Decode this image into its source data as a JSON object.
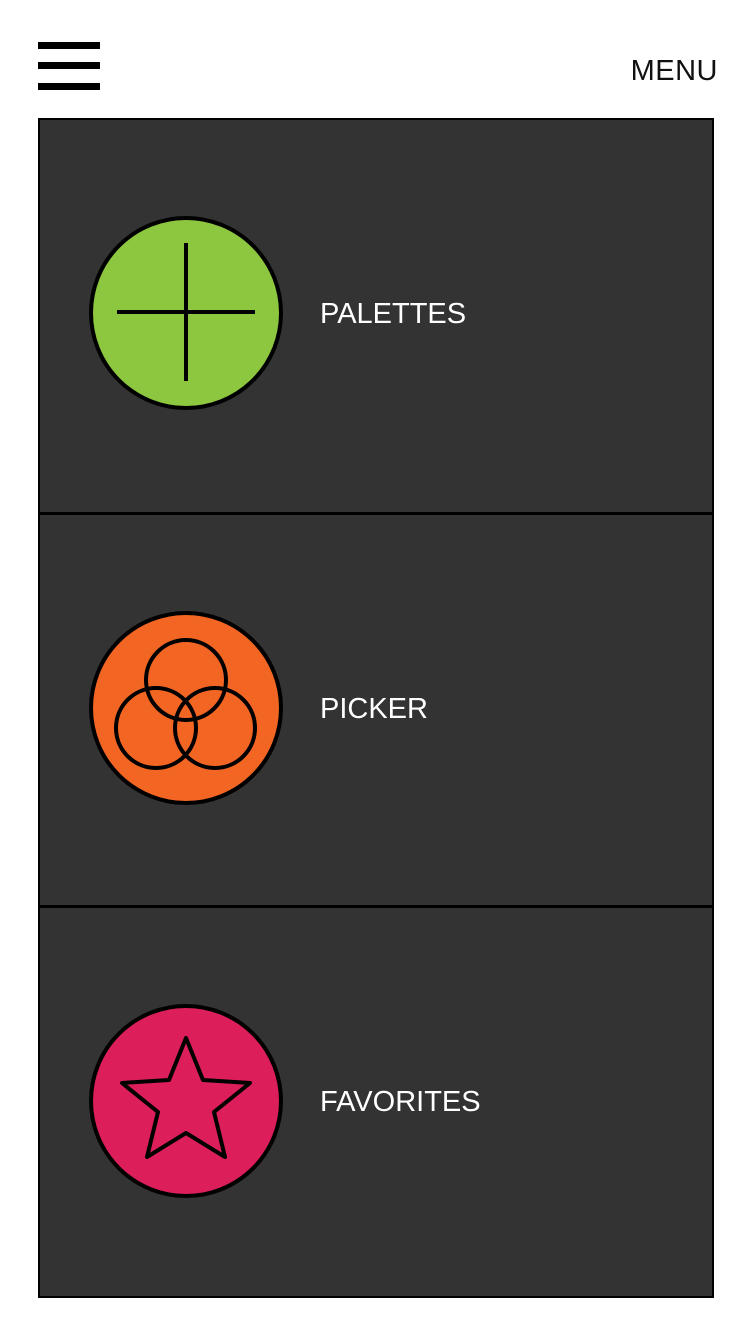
{
  "header": {
    "menu_label": "MENU",
    "hamburger_icon": "hamburger-menu-icon"
  },
  "menu": {
    "items": [
      {
        "label": "PALETTES",
        "icon": "plus-icon",
        "color": "#8dc63f"
      },
      {
        "label": "PICKER",
        "icon": "overlapping-circles-icon",
        "color": "#f26522"
      },
      {
        "label": "FAVORITES",
        "icon": "star-icon",
        "color": "#dc1e5a"
      }
    ]
  },
  "colors": {
    "panel_background": "#333333",
    "divider": "#000000",
    "label_text": "#ffffff"
  }
}
